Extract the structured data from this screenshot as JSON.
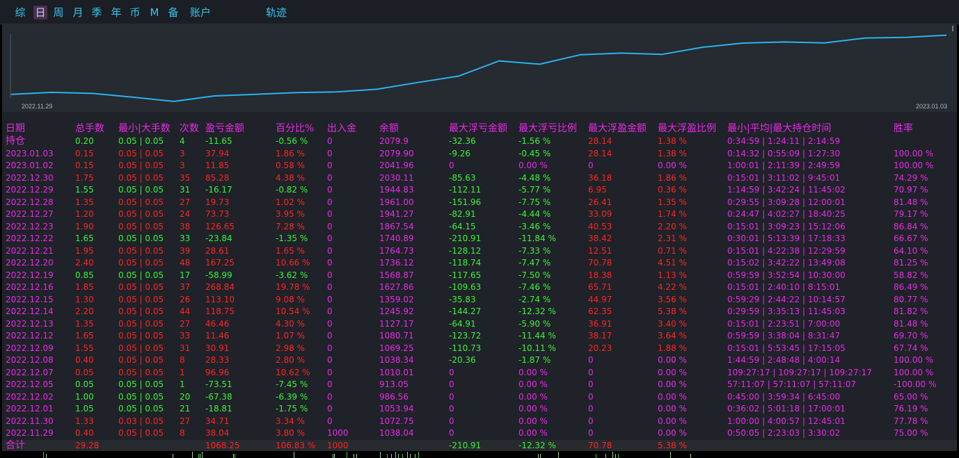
{
  "tabs": [
    {
      "label": "综"
    },
    {
      "label": "日",
      "active": true
    },
    {
      "label": "周"
    },
    {
      "label": "月"
    },
    {
      "label": "季"
    },
    {
      "label": "年"
    },
    {
      "label": "币"
    },
    {
      "label": "M"
    },
    {
      "label": "备"
    },
    {
      "label": "账户"
    },
    {
      "label": "轨迹"
    }
  ],
  "chart": {
    "start_date": "2022.11.29",
    "end_date": "2023.01.03",
    "line_color": "#2ab4ee",
    "ylim": [
      900,
      2100
    ],
    "values": [
      1038.04,
      1072.75,
      1053.94,
      986.56,
      913.05,
      1010.01,
      1038.34,
      1069.25,
      1080.71,
      1127.17,
      1245.92,
      1359.02,
      1627.86,
      1568.87,
      1736.12,
      1764.73,
      1740.89,
      1867.54,
      1941.27,
      1961.0,
      1944.83,
      2030.11,
      2041.96,
      2079.9
    ]
  },
  "columns": [
    "日期",
    "总手数",
    "最小|大手数",
    "次数",
    "盈亏金额",
    "百分比%",
    "出入金",
    "余额",
    "最大浮亏金额",
    "最大浮亏比例",
    "最大浮盈金额",
    "最大浮盈比例",
    "最小|平均|最大持仓时间",
    "胜率"
  ],
  "colors": {
    "red": "#ff2424",
    "green": "#38f538",
    "magenta": "#ea2aea",
    "header": "#e829e8",
    "chart_bg": "#262a31",
    "table_bg": "#1f2228"
  },
  "rows": [
    {
      "date": "持仓",
      "total": "0.20",
      "minmax": "0.05 | 0.05",
      "count": "4",
      "pnl": "-11.65",
      "pct": "-0.56 %",
      "io": "0",
      "balance": "2079.9",
      "max_float_loss": "-32.36",
      "max_float_loss_pct": "-1.56 %",
      "max_float_profit": "28.14",
      "max_float_profit_pct": "1.38 %",
      "hold_time": "0:34:59 | 1:24:11 | 2:14:59",
      "winrate": "",
      "color": "green"
    },
    {
      "date": "2023.01.03",
      "total": "0.15",
      "minmax": "0.05 | 0.05",
      "count": "3",
      "pnl": "37.94",
      "pct": "1.86 %",
      "io": "0",
      "balance": "2079.90",
      "max_float_loss": "-9.26",
      "max_float_loss_pct": "-0.45 %",
      "max_float_profit": "28.14",
      "max_float_profit_pct": "1.38 %",
      "hold_time": "0:14:32 | 0:55:09 | 1:27:30",
      "winrate": "100.00 %",
      "color": "red"
    },
    {
      "date": "2023.01.02",
      "total": "0.15",
      "minmax": "0.05 | 0.05",
      "count": "3",
      "pnl": "11.85",
      "pct": "0.58 %",
      "io": "0",
      "balance": "2041.96",
      "max_float_loss": "0",
      "max_float_loss_pct": "0.00 %",
      "max_float_profit": "0",
      "max_float_profit_pct": "0.00 %",
      "hold_time": "1:00:01 | 2:11:39 | 2:49:59",
      "winrate": "100.00 %",
      "color": "red"
    },
    {
      "date": "2022.12.30",
      "total": "1.75",
      "minmax": "0.05 | 0.05",
      "count": "35",
      "pnl": "85.28",
      "pct": "4.38 %",
      "io": "0",
      "balance": "2030.11",
      "max_float_loss": "-85.63",
      "max_float_loss_pct": "-4.48 %",
      "max_float_profit": "36.18",
      "max_float_profit_pct": "1.86 %",
      "hold_time": "0:15:01 | 3:11:02 | 9:45:01",
      "winrate": "74.29 %",
      "color": "red"
    },
    {
      "date": "2022.12.29",
      "total": "1.55",
      "minmax": "0.05 | 0.05",
      "count": "31",
      "pnl": "-16.17",
      "pct": "-0.82 %",
      "io": "0",
      "balance": "1944.83",
      "max_float_loss": "-112.11",
      "max_float_loss_pct": "-5.77 %",
      "max_float_profit": "6.95",
      "max_float_profit_pct": "0.36 %",
      "hold_time": "1:14:59 | 3:42:24 | 11:45:02",
      "winrate": "70.97 %",
      "color": "green"
    },
    {
      "date": "2022.12.28",
      "total": "1.35",
      "minmax": "0.05 | 0.05",
      "count": "27",
      "pnl": "19.73",
      "pct": "1.02 %",
      "io": "0",
      "balance": "1961.00",
      "max_float_loss": "-151.96",
      "max_float_loss_pct": "-7.75 %",
      "max_float_profit": "26.41",
      "max_float_profit_pct": "1.35 %",
      "hold_time": "0:29:55 | 3:09:28 | 12:00:01",
      "winrate": "81.48 %",
      "color": "red"
    },
    {
      "date": "2022.12.27",
      "total": "1.20",
      "minmax": "0.05 | 0.05",
      "count": "24",
      "pnl": "73.73",
      "pct": "3.95 %",
      "io": "0",
      "balance": "1941.27",
      "max_float_loss": "-82.91",
      "max_float_loss_pct": "-4.44 %",
      "max_float_profit": "33.09",
      "max_float_profit_pct": "1.74 %",
      "hold_time": "0:24:47 | 4:02:27 | 18:40:25",
      "winrate": "79.17 %",
      "color": "red"
    },
    {
      "date": "2022.12.23",
      "total": "1.90",
      "minmax": "0.05 | 0.05",
      "count": "38",
      "pnl": "126.65",
      "pct": "7.28 %",
      "io": "0",
      "balance": "1867.54",
      "max_float_loss": "-64.15",
      "max_float_loss_pct": "-3.46 %",
      "max_float_profit": "40.53",
      "max_float_profit_pct": "2.20 %",
      "hold_time": "0:15:01 | 3:09:23 | 15:12:06",
      "winrate": "86.84 %",
      "color": "red"
    },
    {
      "date": "2022.12.22",
      "total": "1.65",
      "minmax": "0.05 | 0.05",
      "count": "33",
      "pnl": "-23.84",
      "pct": "-1.35 %",
      "io": "0",
      "balance": "1740.89",
      "max_float_loss": "-210.91",
      "max_float_loss_pct": "-11.84 %",
      "max_float_profit": "38.42",
      "max_float_profit_pct": "2.31 %",
      "hold_time": "0:30:01 | 5:13:39 | 17:18:33",
      "winrate": "66.67 %",
      "color": "green"
    },
    {
      "date": "2022.12.21",
      "total": "1.95",
      "minmax": "0.05 | 0.05",
      "count": "39",
      "pnl": "28.61",
      "pct": "1.65 %",
      "io": "0",
      "balance": "1764.73",
      "max_float_loss": "-128.12",
      "max_float_loss_pct": "-7.33 %",
      "max_float_profit": "12.51",
      "max_float_profit_pct": "0.71 %",
      "hold_time": "0:15:01 | 4:22:38 | 12:29:59",
      "winrate": "64.10 %",
      "color": "red"
    },
    {
      "date": "2022.12.20",
      "total": "2.40",
      "minmax": "0.05 | 0.05",
      "count": "48",
      "pnl": "167.25",
      "pct": "10.66 %",
      "io": "0",
      "balance": "1736.12",
      "max_float_loss": "-118.74",
      "max_float_loss_pct": "-7.47 %",
      "max_float_profit": "70.78",
      "max_float_profit_pct": "4.51 %",
      "hold_time": "0:15:02 | 3:42:22 | 13:49:08",
      "winrate": "81.25 %",
      "color": "red"
    },
    {
      "date": "2022.12.19",
      "total": "0.85",
      "minmax": "0.05 | 0.05",
      "count": "17",
      "pnl": "-58.99",
      "pct": "-3.62 %",
      "io": "0",
      "balance": "1568.87",
      "max_float_loss": "-117.65",
      "max_float_loss_pct": "-7.50 %",
      "max_float_profit": "18.38",
      "max_float_profit_pct": "1.13 %",
      "hold_time": "0:59:59 | 3:52:54 | 10:30:00",
      "winrate": "58.82 %",
      "color": "green"
    },
    {
      "date": "2022.12.16",
      "total": "1.85",
      "minmax": "0.05 | 0.05",
      "count": "37",
      "pnl": "268.84",
      "pct": "19.78 %",
      "io": "0",
      "balance": "1627.86",
      "max_float_loss": "-109.63",
      "max_float_loss_pct": "-7.46 %",
      "max_float_profit": "65.71",
      "max_float_profit_pct": "4.22 %",
      "hold_time": "0:15:01 | 2:40:10 | 8:15:01",
      "winrate": "86.49 %",
      "color": "red"
    },
    {
      "date": "2022.12.15",
      "total": "1.30",
      "minmax": "0.05 | 0.05",
      "count": "26",
      "pnl": "113.10",
      "pct": "9.08 %",
      "io": "0",
      "balance": "1359.02",
      "max_float_loss": "-35.83",
      "max_float_loss_pct": "-2.74 %",
      "max_float_profit": "44.97",
      "max_float_profit_pct": "3.56 %",
      "hold_time": "0:59:29 | 2:44:22 | 10:14:57",
      "winrate": "80.77 %",
      "color": "red"
    },
    {
      "date": "2022.12.14",
      "total": "2.20",
      "minmax": "0.05 | 0.05",
      "count": "44",
      "pnl": "118.75",
      "pct": "10.54 %",
      "io": "0",
      "balance": "1245.92",
      "max_float_loss": "-144.27",
      "max_float_loss_pct": "-12.32 %",
      "max_float_profit": "62.35",
      "max_float_profit_pct": "5.38 %",
      "hold_time": "0:29:59 | 3:35:13 | 11:45:03",
      "winrate": "81.82 %",
      "color": "red"
    },
    {
      "date": "2022.12.13",
      "total": "1.35",
      "minmax": "0.05 | 0.05",
      "count": "27",
      "pnl": "46.46",
      "pct": "4.30 %",
      "io": "0",
      "balance": "1127.17",
      "max_float_loss": "-64.91",
      "max_float_loss_pct": "-5.90 %",
      "max_float_profit": "36.91",
      "max_float_profit_pct": "3.40 %",
      "hold_time": "0:15:01 | 2:23:51 | 7:00:00",
      "winrate": "81.48 %",
      "color": "red"
    },
    {
      "date": "2022.12.12",
      "total": "1.65",
      "minmax": "0.05 | 0.05",
      "count": "33",
      "pnl": "11.46",
      "pct": "1.07 %",
      "io": "0",
      "balance": "1080.71",
      "max_float_loss": "-123.72",
      "max_float_loss_pct": "-11.44 %",
      "max_float_profit": "38.17",
      "max_float_profit_pct": "3.64 %",
      "hold_time": "0:59:59 | 3:38:04 | 8:31:47",
      "winrate": "69.70 %",
      "color": "red"
    },
    {
      "date": "2022.12.09",
      "total": "1.55",
      "minmax": "0.05 | 0.05",
      "count": "31",
      "pnl": "30.91",
      "pct": "2.98 %",
      "io": "0",
      "balance": "1069.25",
      "max_float_loss": "-110.73",
      "max_float_loss_pct": "-10.11 %",
      "max_float_profit": "20.23",
      "max_float_profit_pct": "1.88 %",
      "hold_time": "0:15:01 | 5:53:45 | 17:15:05",
      "winrate": "67.74 %",
      "color": "red"
    },
    {
      "date": "2022.12.08",
      "total": "0.40",
      "minmax": "0.05 | 0.05",
      "count": "8",
      "pnl": "28.33",
      "pct": "2.80 %",
      "io": "0",
      "balance": "1038.34",
      "max_float_loss": "-20.36",
      "max_float_loss_pct": "-1.87 %",
      "max_float_profit": "0",
      "max_float_profit_pct": "0.00 %",
      "hold_time": "1:44:59 | 2:48:48 | 4:00:14",
      "winrate": "100.00 %",
      "color": "red"
    },
    {
      "date": "2022.12.07",
      "total": "0.05",
      "minmax": "0.05 | 0.05",
      "count": "1",
      "pnl": "96.96",
      "pct": "10.62 %",
      "io": "0",
      "balance": "1010.01",
      "max_float_loss": "0",
      "max_float_loss_pct": "0.00 %",
      "max_float_profit": "0",
      "max_float_profit_pct": "0.00 %",
      "hold_time": "109:27:17 | 109:27:17 | 109:27:17",
      "winrate": "100.00 %",
      "color": "red"
    },
    {
      "date": "2022.12.05",
      "total": "0.05",
      "minmax": "0.05 | 0.05",
      "count": "1",
      "pnl": "-73.51",
      "pct": "-7.45 %",
      "io": "0",
      "balance": "913.05",
      "max_float_loss": "0",
      "max_float_loss_pct": "0.00 %",
      "max_float_profit": "0",
      "max_float_profit_pct": "0.00 %",
      "hold_time": "57:11:07 | 57:11:07 | 57:11:07",
      "winrate": "-100.00 %",
      "color": "green"
    },
    {
      "date": "2022.12.02",
      "total": "1.00",
      "minmax": "0.05 | 0.05",
      "count": "20",
      "pnl": "-67.38",
      "pct": "-6.39 %",
      "io": "0",
      "balance": "986.56",
      "max_float_loss": "0",
      "max_float_loss_pct": "0.00 %",
      "max_float_profit": "0",
      "max_float_profit_pct": "0.00 %",
      "hold_time": "0:45:00 | 3:59:34 | 6:45:00",
      "winrate": "65.00 %",
      "color": "green"
    },
    {
      "date": "2022.12.01",
      "total": "1.05",
      "minmax": "0.05 | 0.05",
      "count": "21",
      "pnl": "-18.81",
      "pct": "-1.75 %",
      "io": "0",
      "balance": "1053.94",
      "max_float_loss": "0",
      "max_float_loss_pct": "0.00 %",
      "max_float_profit": "0",
      "max_float_profit_pct": "0.00 %",
      "hold_time": "0:36:02 | 5:01:18 | 17:00:01",
      "winrate": "76.19 %",
      "color": "green"
    },
    {
      "date": "2022.11.30",
      "total": "1.33",
      "minmax": "0.03 | 0.05",
      "count": "27",
      "pnl": "34.71",
      "pct": "3.34 %",
      "io": "0",
      "balance": "1072.75",
      "max_float_loss": "0",
      "max_float_loss_pct": "0.00 %",
      "max_float_profit": "0",
      "max_float_profit_pct": "0.00 %",
      "hold_time": "1:00:00 | 4:00:57 | 12:45:01",
      "winrate": "77.78 %",
      "color": "red"
    },
    {
      "date": "2022.11.29",
      "total": "0.40",
      "minmax": "0.05 | 0.05",
      "count": "8",
      "pnl": "38.04",
      "pct": "3.80 %",
      "io": "1000",
      "balance": "1038.04",
      "max_float_loss": "0",
      "max_float_loss_pct": "0.00 %",
      "max_float_profit": "0",
      "max_float_profit_pct": "0.00 %",
      "hold_time": "0:50:05 | 2:23:03 | 3:30:02",
      "winrate": "75.00 %",
      "color": "red"
    }
  ],
  "totals": {
    "label": "合计",
    "total": "29.28",
    "pnl": "1068.25",
    "pct": "106.83 %",
    "io": "1000",
    "max_float_loss": "-210.91",
    "max_float_loss_pct": "-12.32 %",
    "max_float_profit": "70.78",
    "max_float_profit_pct": "5.38 %"
  }
}
